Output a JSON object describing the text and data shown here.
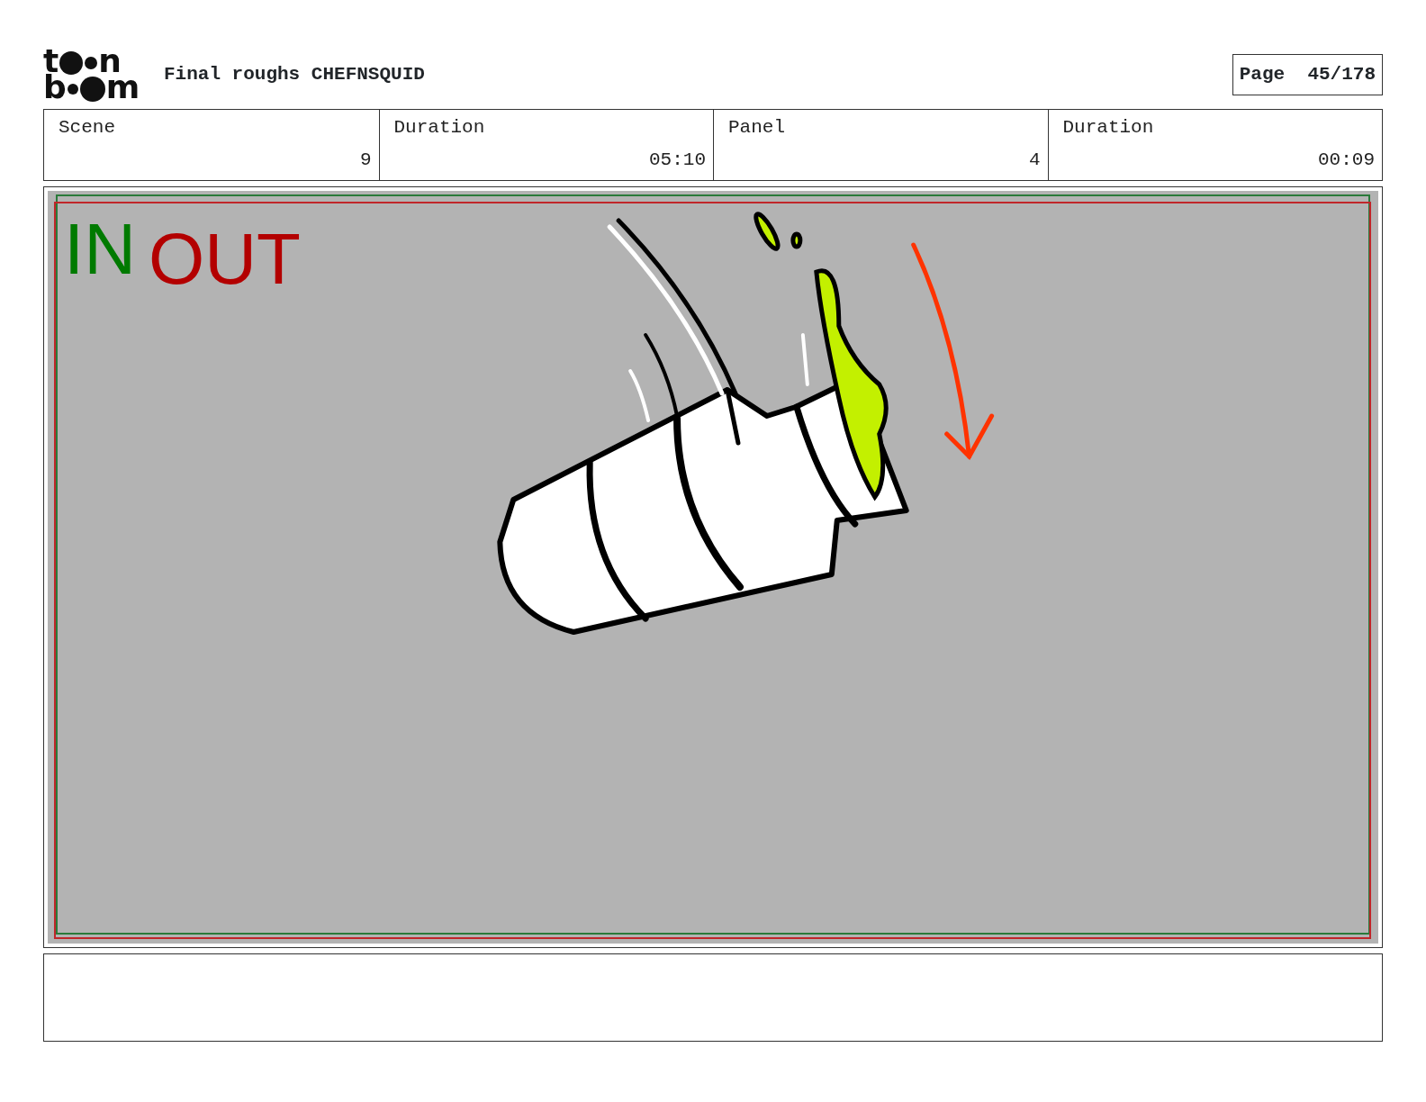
{
  "header": {
    "logo": {
      "top": [
        "t",
        "n"
      ],
      "bottom": [
        "b",
        "m"
      ]
    },
    "title": "Final roughs CHEFNSQUID",
    "page_label": "Page",
    "page_number": "45/178"
  },
  "info": [
    {
      "label": "Scene",
      "value": "9"
    },
    {
      "label": "Duration",
      "value": "05:10"
    },
    {
      "label": "Panel",
      "value": "4"
    },
    {
      "label": "Duration",
      "value": "00:09"
    }
  ],
  "panel": {
    "in_marker": "IN",
    "out_marker": "OUT"
  }
}
